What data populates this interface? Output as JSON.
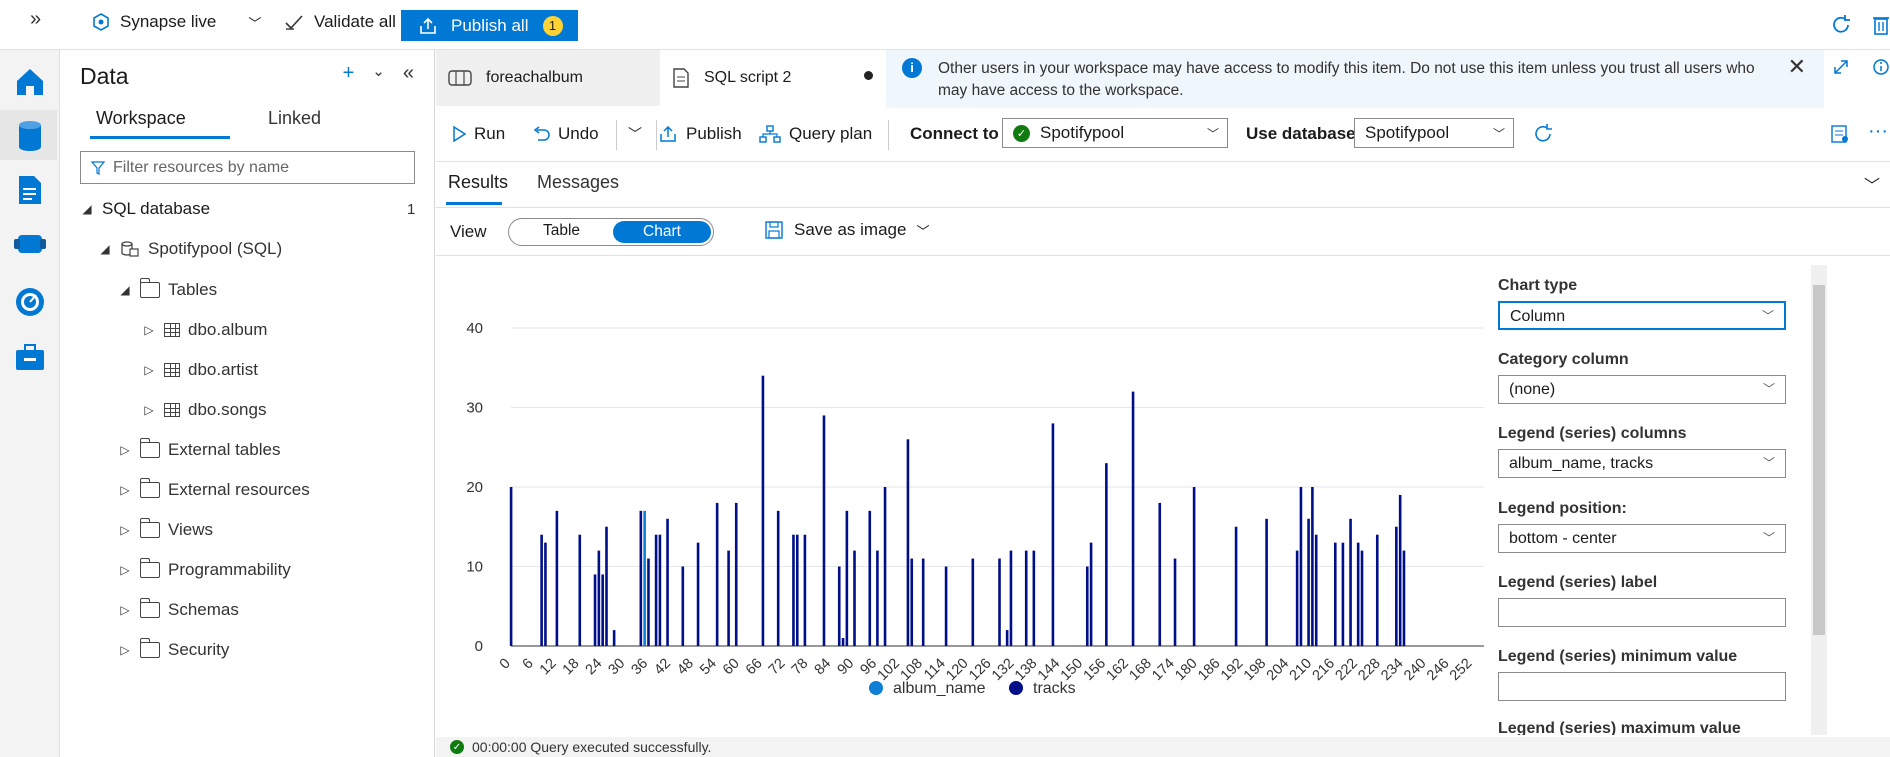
{
  "topbar": {
    "workspace_label": "Synapse live",
    "validate_label": "Validate all",
    "publish_label": "Publish all",
    "publish_count": "1"
  },
  "datapanel": {
    "title": "Data",
    "tabs": [
      "Workspace",
      "Linked"
    ],
    "filter_placeholder": "Filter resources by name",
    "section_label": "SQL database",
    "section_count": "1",
    "tree": [
      {
        "label": "Spotifypool (SQL)",
        "level": 1,
        "icon": "database-icon"
      },
      {
        "label": "Tables",
        "level": 2,
        "icon": "folder-icon"
      },
      {
        "label": "dbo.album",
        "level": 3,
        "icon": "table-icon"
      },
      {
        "label": "dbo.artist",
        "level": 3,
        "icon": "table-icon"
      },
      {
        "label": "dbo.songs",
        "level": 3,
        "icon": "table-icon"
      },
      {
        "label": "External tables",
        "level": 2,
        "icon": "folder-icon"
      },
      {
        "label": "External resources",
        "level": 2,
        "icon": "folder-icon"
      },
      {
        "label": "Views",
        "level": 2,
        "icon": "folder-icon"
      },
      {
        "label": "Programmability",
        "level": 2,
        "icon": "folder-icon"
      },
      {
        "label": "Schemas",
        "level": 2,
        "icon": "folder-icon"
      },
      {
        "label": "Security",
        "level": 2,
        "icon": "folder-icon"
      }
    ]
  },
  "editor": {
    "tabs": [
      "foreachalbum",
      "SQL script 2"
    ],
    "info_message": "Other users in your workspace may have access to modify this item. Do not use this item unless you trust all users who may have access to the workspace.",
    "toolbar": {
      "run": "Run",
      "undo": "Undo",
      "publish": "Publish",
      "query_plan": "Query plan",
      "connect_to_label": "Connect to",
      "connect_to_value": "Spotifypool",
      "use_database_label": "Use database",
      "use_database_value": "Spotifypool"
    },
    "result_tabs": [
      "Results",
      "Messages"
    ],
    "view_label": "View",
    "view_options": [
      "Table",
      "Chart"
    ],
    "save_image": "Save as image",
    "status": "00:00:00 Query executed successfully."
  },
  "chart_settings": {
    "chart_type_label": "Chart type",
    "chart_type_value": "Column",
    "category_label": "Category column",
    "category_value": "(none)",
    "legend_columns_label": "Legend (series) columns",
    "legend_columns_value": "album_name, tracks",
    "legend_position_label": "Legend position:",
    "legend_position_value": "bottom - center",
    "legend_label_label": "Legend (series) label",
    "legend_min_label": "Legend (series) minimum value",
    "legend_max_label": "Legend (series) maximum value"
  },
  "chart_data": {
    "type": "bar",
    "ylim": [
      0,
      40
    ],
    "yticks": [
      0,
      10,
      20,
      30,
      40
    ],
    "xticks": [
      0,
      6,
      12,
      18,
      24,
      30,
      36,
      42,
      48,
      54,
      60,
      66,
      72,
      78,
      84,
      90,
      96,
      102,
      108,
      114,
      120,
      126,
      132,
      138,
      144,
      150,
      156,
      162,
      168,
      174,
      180,
      186,
      192,
      198,
      204,
      210,
      216,
      222,
      228,
      234,
      240,
      246,
      252
    ],
    "x_max": 255,
    "grid": true,
    "legend_position": "bottom-center",
    "series": [
      {
        "name": "album_name",
        "color": "#0f7fd6",
        "points": [
          [
            35,
            17
          ]
        ]
      },
      {
        "name": "tracks",
        "color": "#000f88",
        "points": [
          [
            0,
            20
          ],
          [
            8,
            14
          ],
          [
            9,
            13
          ],
          [
            12,
            17
          ],
          [
            18,
            14
          ],
          [
            22,
            9
          ],
          [
            23,
            12
          ],
          [
            24,
            9
          ],
          [
            25,
            15
          ],
          [
            27,
            2
          ],
          [
            34,
            17
          ],
          [
            36,
            11
          ],
          [
            38,
            14
          ],
          [
            39,
            14
          ],
          [
            41,
            16
          ],
          [
            45,
            10
          ],
          [
            49,
            13
          ],
          [
            54,
            18
          ],
          [
            57,
            12
          ],
          [
            59,
            18
          ],
          [
            66,
            34
          ],
          [
            70,
            17
          ],
          [
            74,
            14
          ],
          [
            75,
            14
          ],
          [
            77,
            14
          ],
          [
            82,
            29
          ],
          [
            86,
            10
          ],
          [
            87,
            1
          ],
          [
            88,
            17
          ],
          [
            90,
            12
          ],
          [
            94,
            17
          ],
          [
            96,
            12
          ],
          [
            98,
            20
          ],
          [
            104,
            26
          ],
          [
            105,
            11
          ],
          [
            108,
            11
          ],
          [
            114,
            10
          ],
          [
            121,
            11
          ],
          [
            128,
            11
          ],
          [
            130,
            2
          ],
          [
            131,
            12
          ],
          [
            135,
            12
          ],
          [
            137,
            12
          ],
          [
            142,
            28
          ],
          [
            151,
            10
          ],
          [
            152,
            13
          ],
          [
            156,
            23
          ],
          [
            163,
            32
          ],
          [
            170,
            18
          ],
          [
            174,
            11
          ],
          [
            179,
            20
          ],
          [
            190,
            15
          ],
          [
            198,
            16
          ],
          [
            206,
            12
          ],
          [
            207,
            20
          ],
          [
            209,
            16
          ],
          [
            210,
            20
          ],
          [
            211,
            14
          ],
          [
            216,
            13
          ],
          [
            218,
            13
          ],
          [
            220,
            16
          ],
          [
            222,
            13
          ],
          [
            223,
            12
          ],
          [
            227,
            14
          ],
          [
            232,
            15
          ],
          [
            233,
            19
          ],
          [
            234,
            12
          ]
        ]
      }
    ]
  }
}
